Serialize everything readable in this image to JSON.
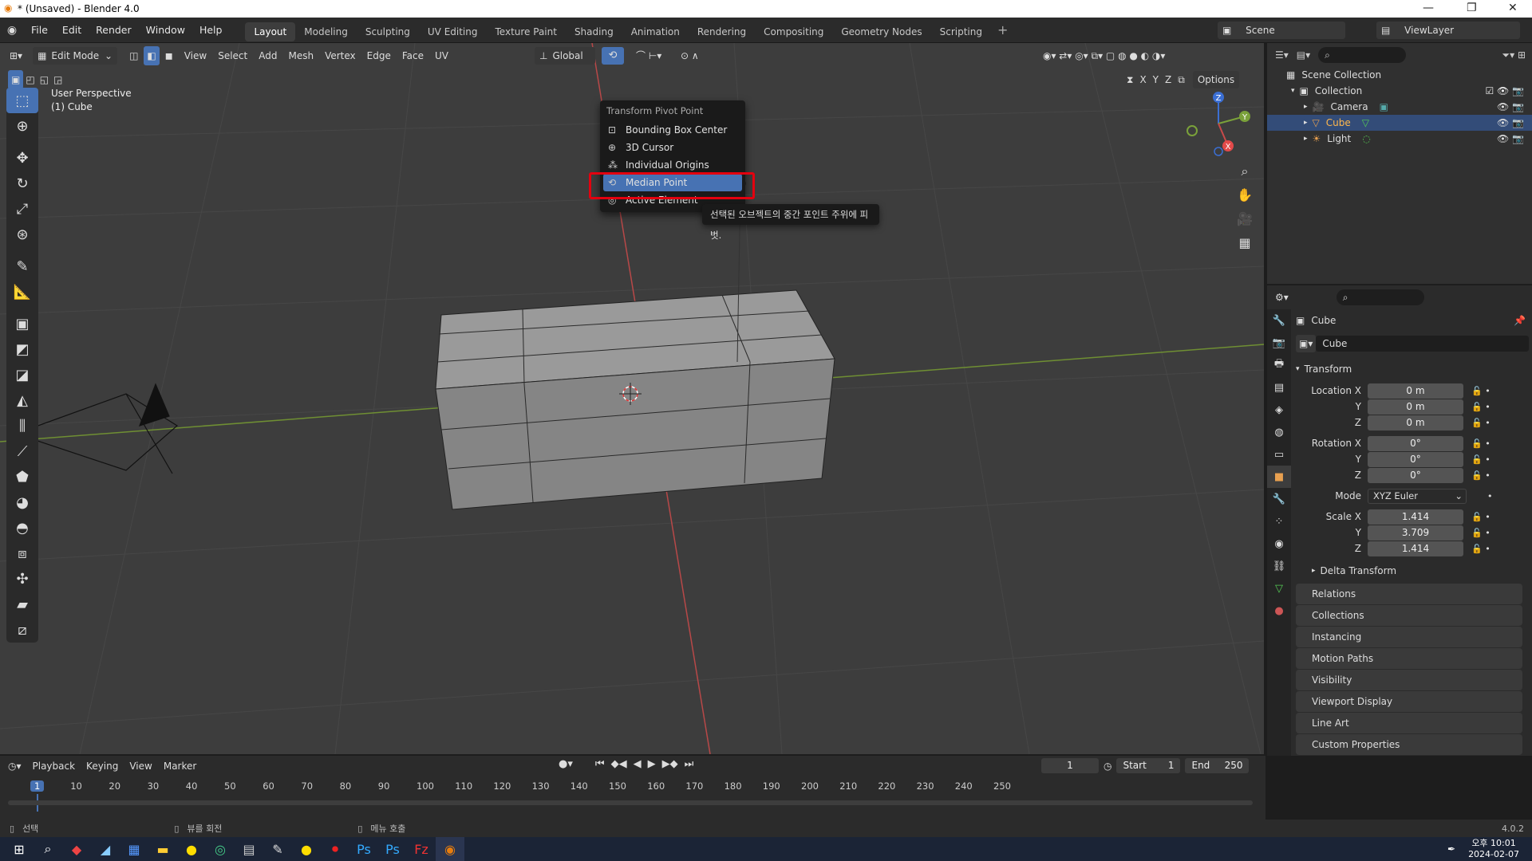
{
  "window": {
    "title": "* (Unsaved) - Blender 4.0"
  },
  "menu": [
    "File",
    "Edit",
    "Render",
    "Window",
    "Help"
  ],
  "workspaces": [
    "Layout",
    "Modeling",
    "Sculpting",
    "UV Editing",
    "Texture Paint",
    "Shading",
    "Animation",
    "Rendering",
    "Compositing",
    "Geometry Nodes",
    "Scripting"
  ],
  "scene": {
    "label": "Scene",
    "view_layer": "ViewLayer"
  },
  "viewport_header": {
    "mode": "Edit Mode",
    "menus": [
      "View",
      "Select",
      "Add",
      "Mesh",
      "Vertex",
      "Edge",
      "Face",
      "UV"
    ],
    "orientation": "Global",
    "options": "Options",
    "axes": [
      "X",
      "Y",
      "Z"
    ]
  },
  "viewport": {
    "perspective": "User Perspective",
    "object": "(1) Cube"
  },
  "pivot_menu": {
    "title": "Transform Pivot Point",
    "items": [
      "Bounding Box Center",
      "3D Cursor",
      "Individual Origins",
      "Median Point",
      "Active Element"
    ],
    "selected": "Median Point",
    "tooltip": "선택된 오브젝트의 중간 포인트 주위에 피벗."
  },
  "outliner": {
    "root": "Scene Collection",
    "collection": "Collection",
    "items": [
      "Camera",
      "Cube",
      "Light"
    ]
  },
  "properties": {
    "object_name": "Cube",
    "data_name": "Cube",
    "transform_label": "Transform",
    "location_label": "Location X",
    "location": [
      "0 m",
      "0 m",
      "0 m"
    ],
    "rotation_label": "Rotation X",
    "rotation": [
      "0°",
      "0°",
      "0°"
    ],
    "mode_label": "Mode",
    "mode_value": "XYZ Euler",
    "scale_label": "Scale X",
    "scale": [
      "1.414",
      "3.709",
      "1.414"
    ],
    "yz": [
      "Y",
      "Z"
    ],
    "delta": "Delta Transform",
    "panels": [
      "Relations",
      "Collections",
      "Instancing",
      "Motion Paths",
      "Visibility",
      "Viewport Display",
      "Line Art",
      "Custom Properties"
    ]
  },
  "timeline": {
    "menus": [
      "Playback",
      "Keying",
      "View",
      "Marker"
    ],
    "current_frame": "1",
    "start_label": "Start",
    "start": "1",
    "end_label": "End",
    "end": "250",
    "ticks": [
      "1",
      "10",
      "20",
      "30",
      "40",
      "50",
      "60",
      "70",
      "80",
      "90",
      "100",
      "110",
      "120",
      "130",
      "140",
      "150",
      "160",
      "170",
      "180",
      "190",
      "200",
      "210",
      "220",
      "230",
      "240",
      "250"
    ]
  },
  "status": {
    "select": "선택",
    "rotate": "뷰를 회전",
    "menu": "메뉴 호출",
    "version": "4.0.2"
  },
  "taskbar": {
    "time": "오후 10:01",
    "date": "2024-02-07"
  },
  "colors": {
    "accent": "#4772b3",
    "highlight": "#e3000f",
    "x_axis": "#c84a4a",
    "y_axis": "#7aa13a"
  }
}
